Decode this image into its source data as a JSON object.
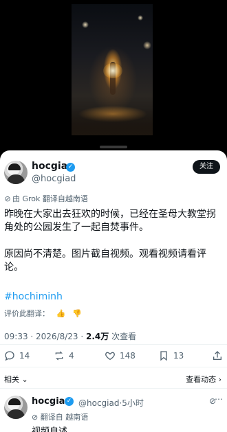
{
  "post": {
    "display_name": "hocgia",
    "handle": "@hocgiad",
    "follow_label": "关注",
    "translated_by": "由 Grok 翻译自越南语",
    "paragraph1": "昨晚在大家出去狂欢的时候，已经在圣母大教堂拐角处的公园发生了一起自焚事件。",
    "paragraph2": "原因尚不清楚。图片截自视频。观看视频请看评论。",
    "hashtag": "#hochiminh",
    "rate_translation": "评价此翻译：",
    "time": "09:33 · 2026/8/23 · ",
    "views": "2.4万",
    "views_label": " 次查看"
  },
  "actions": {
    "replies": "14",
    "reposts": "4",
    "likes": "148",
    "bookmarks": "13"
  },
  "related": {
    "label": "相关",
    "view_label": "查看动态"
  },
  "reply": {
    "display_name": "hocgia",
    "handle": "@hocgiad·5小时",
    "translated": "翻译自 越南语",
    "text": "视频自述"
  },
  "icons": {
    "verified": "verified-badge-icon",
    "reply": "reply-icon",
    "repost": "repost-icon",
    "like": "heart-icon",
    "bookmark": "bookmark-icon",
    "share": "share-icon",
    "grok": "grok-icon",
    "more": "more-icon",
    "thumbs_up": "thumbs-up-icon",
    "thumbs_down": "thumbs-down-icon",
    "chevron_down": "chevron-down-icon",
    "chevron_right": "chevron-right-icon"
  },
  "colors": {
    "accent": "#1d9bf0",
    "text": "#0f1419",
    "muted": "#536471",
    "background_media": "#000000",
    "sheet": "#ffffff"
  }
}
